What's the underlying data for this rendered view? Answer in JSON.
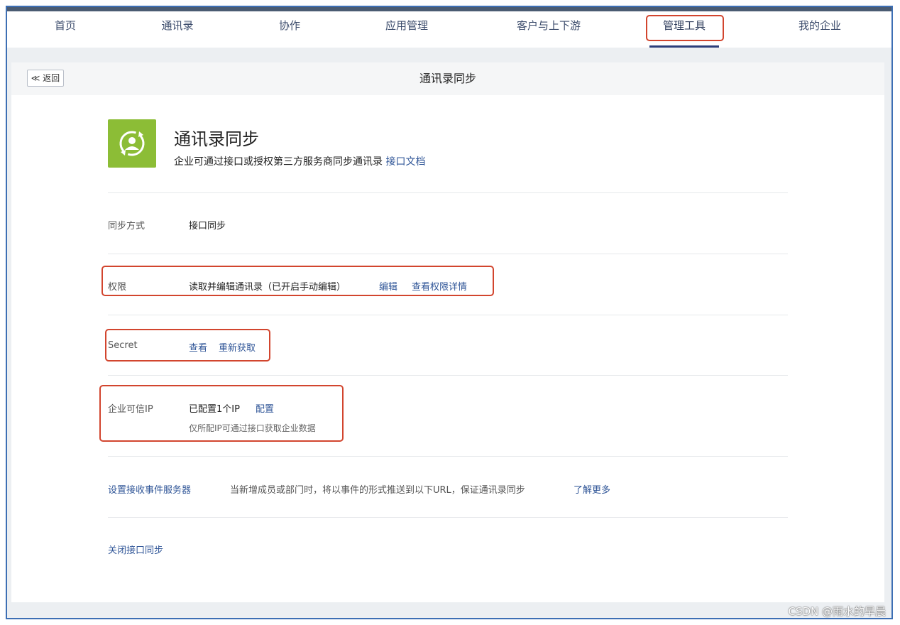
{
  "nav": {
    "items": [
      {
        "label": "首页"
      },
      {
        "label": "通讯录"
      },
      {
        "label": "协作"
      },
      {
        "label": "应用管理"
      },
      {
        "label": "客户与上下游"
      },
      {
        "label": "管理工具"
      },
      {
        "label": "我的企业"
      }
    ],
    "active": "管理工具"
  },
  "header": {
    "back_label": "≪ 返回",
    "title": "通讯录同步"
  },
  "app": {
    "icon": "sync-contacts-icon",
    "icon_color": "#8cbd36",
    "title": "通讯录同步",
    "description": "企业可通过接口或授权第三方服务商同步通讯录",
    "doc_link": "接口文档"
  },
  "rows": {
    "sync_mode": {
      "label": "同步方式",
      "value": "接口同步"
    },
    "permission": {
      "label": "权限",
      "value": "读取并编辑通讯录（已开启手动编辑）",
      "edit_link": "编辑",
      "details_link": "查看权限详情"
    },
    "secret": {
      "label": "Secret",
      "view_link": "查看",
      "refresh_link": "重新获取"
    },
    "trusted_ip": {
      "label": "企业可信IP",
      "value": "已配置1个IP",
      "config_link": "配置",
      "hint": "仅所配IP可通过接口获取企业数据"
    },
    "event_server": {
      "link": "设置接收事件服务器",
      "description": "当新增成员或部门时，将以事件的形式推送到以下URL，保证通讯录同步",
      "more_link": "了解更多"
    },
    "close": {
      "link": "关闭接口同步"
    }
  },
  "watermark": "CSDN @雨水的早晨",
  "colors": {
    "accent": "#2f5597",
    "highlight": "#d2452e",
    "nav_bar": "#4a5b72",
    "frame": "#3d6fb4"
  }
}
